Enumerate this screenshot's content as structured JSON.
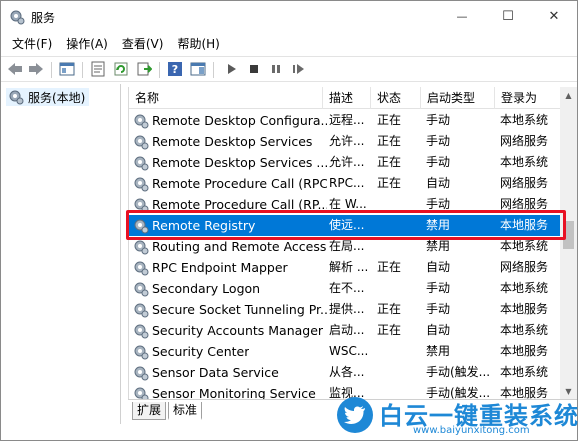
{
  "window": {
    "title": "服务",
    "minimize_glyph": "—",
    "maximize_glyph": "☐",
    "close_glyph": "✕"
  },
  "menu": [
    "文件(F)",
    "操作(A)",
    "查看(V)",
    "帮助(H)"
  ],
  "toolbar_icons": [
    "back-arrow-icon",
    "forward-arrow-icon",
    "show-console-tree-icon",
    "properties-icon",
    "refresh-icon",
    "export-list-icon",
    "help-icon",
    "show-hide-action-pane-icon",
    "start-service-icon",
    "stop-service-icon",
    "pause-service-icon",
    "restart-service-icon"
  ],
  "tree": {
    "root_label": "服务(本地)"
  },
  "columns": {
    "name": "名称",
    "desc": "描述",
    "status": "状态",
    "start": "启动类型",
    "logon": "登录为"
  },
  "rows": [
    {
      "name": "Remote Desktop Configura...",
      "desc": "远程...",
      "status": "正在",
      "start": "手动",
      "logon": "本地系统"
    },
    {
      "name": "Remote Desktop Services",
      "desc": "允许...",
      "status": "正在",
      "start": "手动",
      "logon": "网络服务"
    },
    {
      "name": "Remote Desktop Services ...",
      "desc": "允许...",
      "status": "正在",
      "start": "手动",
      "logon": "本地系统"
    },
    {
      "name": "Remote Procedure Call (RPC)",
      "desc": "RPC...",
      "status": "正在",
      "start": "自动",
      "logon": "网络服务"
    },
    {
      "name": "Remote Procedure Call (RP...",
      "desc": "在 W...",
      "status": "",
      "start": "手动",
      "logon": "网络服务"
    },
    {
      "name": "Remote Registry",
      "desc": "使远...",
      "status": "",
      "start": "禁用",
      "logon": "本地服务",
      "selected": true
    },
    {
      "name": "Routing and Remote Access",
      "desc": "在局...",
      "status": "",
      "start": "禁用",
      "logon": "本地系统"
    },
    {
      "name": "RPC Endpoint Mapper",
      "desc": "解析 ...",
      "status": "正在",
      "start": "自动",
      "logon": "网络服务"
    },
    {
      "name": "Secondary Logon",
      "desc": "在不...",
      "status": "",
      "start": "手动",
      "logon": "本地系统"
    },
    {
      "name": "Secure Socket Tunneling Pr...",
      "desc": "提供...",
      "status": "正在",
      "start": "手动",
      "logon": "本地服务"
    },
    {
      "name": "Security Accounts Manager",
      "desc": "启动...",
      "status": "正在",
      "start": "自动",
      "logon": "本地系统"
    },
    {
      "name": "Security Center",
      "desc": "WSC...",
      "status": "",
      "start": "禁用",
      "logon": "本地服务"
    },
    {
      "name": "Sensor Data Service",
      "desc": "从各...",
      "status": "",
      "start": "手动(触发...",
      "logon": "本地系统"
    },
    {
      "name": "Sensor Monitoring Service",
      "desc": "监视...",
      "status": "",
      "start": "手动(触发...",
      "logon": "本地服务"
    }
  ],
  "tabs": [
    "扩展",
    "标准"
  ],
  "watermark": {
    "title": "白云一键重装系统",
    "url": "www.baiyunxitong.com"
  },
  "colors": {
    "selection": "#0078d7",
    "highlight_box": "#e81123",
    "watermark": "#1e88d6"
  }
}
